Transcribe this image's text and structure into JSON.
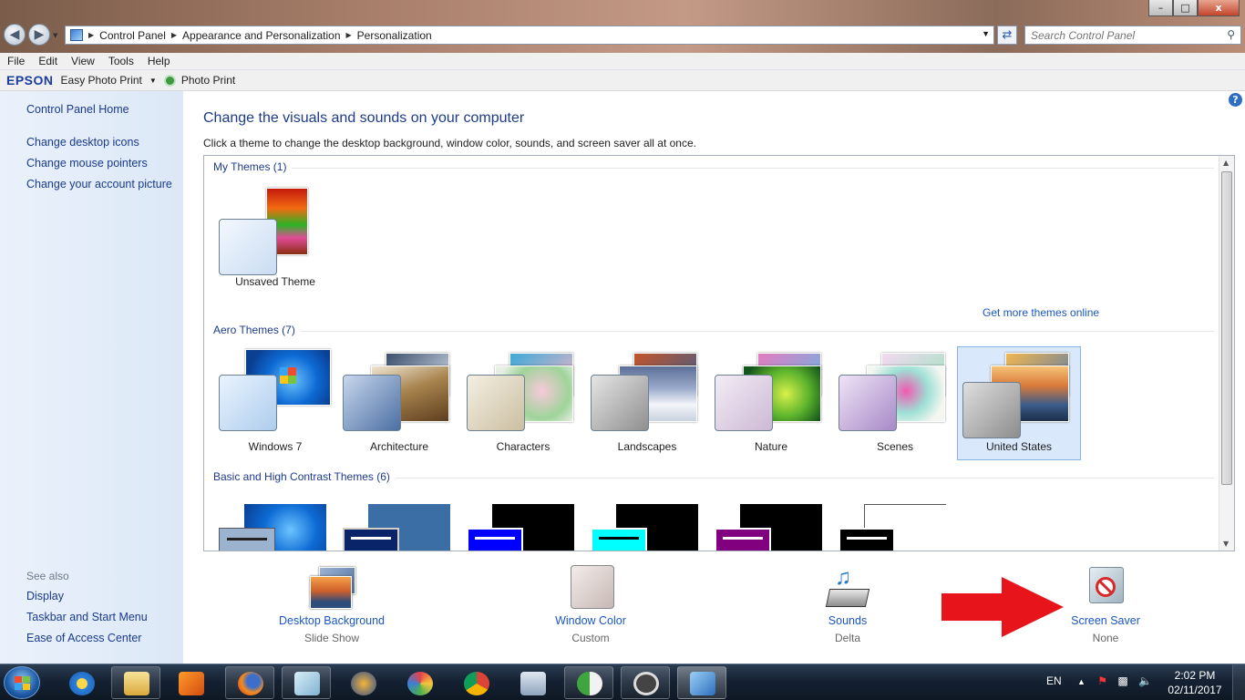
{
  "window": {
    "breadcrumb": [
      "Control Panel",
      "Appearance and Personalization",
      "Personalization"
    ],
    "search_placeholder": "Search Control Panel",
    "buttons": {
      "minimize": "–",
      "maximize": "□",
      "close": "x"
    }
  },
  "menu": [
    "File",
    "Edit",
    "View",
    "Tools",
    "Help"
  ],
  "epson_toolbar": {
    "brand": "EPSON",
    "easy_photo_print": "Easy Photo Print",
    "photo_print": "Photo Print"
  },
  "sidebar": {
    "home": "Control Panel Home",
    "links": [
      "Change desktop icons",
      "Change mouse pointers",
      "Change your account picture"
    ],
    "see_also_heading": "See also",
    "see_also": [
      "Display",
      "Taskbar and Start Menu",
      "Ease of Access Center"
    ]
  },
  "main": {
    "title": "Change the visuals and sounds on your computer",
    "subtitle": "Click a theme to change the desktop background, window color, sounds, and screen saver all at once.",
    "my_themes": {
      "heading": "My Themes (1)",
      "items": [
        "Unsaved Theme"
      ]
    },
    "get_more": "Get more themes online",
    "aero_themes": {
      "heading": "Aero Themes (7)",
      "items": [
        "Windows 7",
        "Architecture",
        "Characters",
        "Landscapes",
        "Nature",
        "Scenes",
        "United States"
      ],
      "selected": "United States"
    },
    "basic_themes": {
      "heading": "Basic and High Contrast Themes (6)"
    }
  },
  "bottom": {
    "desktop_background": {
      "name": "Desktop Background",
      "value": "Slide Show"
    },
    "window_color": {
      "name": "Window Color",
      "value": "Custom"
    },
    "sounds": {
      "name": "Sounds",
      "value": "Delta"
    },
    "screen_saver": {
      "name": "Screen Saver",
      "value": "None"
    }
  },
  "taskbar": {
    "language": "EN",
    "time": "2:02 PM",
    "date": "02/11/2017"
  },
  "colors": {
    "link": "#1a56c0",
    "heading": "#1e3b8a",
    "arrow": "#e8141c",
    "selection": "#d9e8fb"
  }
}
